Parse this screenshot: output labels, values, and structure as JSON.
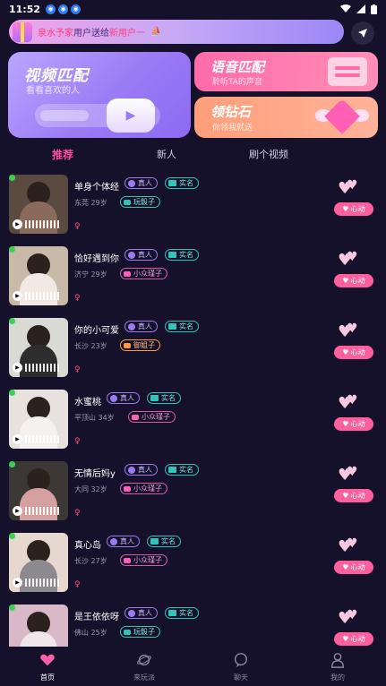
{
  "status": {
    "time": "11:52"
  },
  "notice": {
    "highlight_before": "泉水予家",
    "text": "用户送给",
    "highlight_after": "新用户一"
  },
  "cards": {
    "video": {
      "title": "视频匹配",
      "subtitle": "看看喜欢的人"
    },
    "voice": {
      "title": "语音匹配",
      "subtitle": "聆听TA的声音"
    },
    "diamond": {
      "title": "领钻石",
      "subtitle": "你领我就送"
    }
  },
  "tabs": [
    "推荐",
    "新人",
    "刷个视频"
  ],
  "badges": {
    "real": "真人",
    "name": "实名",
    "like": "心动"
  },
  "users": [
    {
      "name": "单身个体经",
      "city": "东莞",
      "age": "29岁",
      "tag": "玩骰子",
      "tag_style": "teal",
      "gender": "♀"
    },
    {
      "name": "恰好遇到你",
      "city": "济宁",
      "age": "29岁",
      "tag": "小众瑾子",
      "tag_style": "pink",
      "gender": "♀"
    },
    {
      "name": "你的小可爱",
      "city": "长沙",
      "age": "23岁",
      "tag": "御姐子",
      "tag_style": "orange",
      "gender": "♀"
    },
    {
      "name": "水蜜桃",
      "city": "平顶山",
      "age": "34岁",
      "tag": "小众瑾子",
      "tag_style": "pink",
      "gender": "♀"
    },
    {
      "name": "无情后妈y",
      "city": "大同",
      "age": "32岁",
      "tag": "小众瑾子",
      "tag_style": "pink",
      "gender": "♀"
    },
    {
      "name": "真心岛",
      "city": "长沙",
      "age": "27岁",
      "tag": "小众瑾子",
      "tag_style": "pink",
      "gender": "♀"
    },
    {
      "name": "是王依依呀",
      "city": "佛山",
      "age": "25岁",
      "tag": "玩骰子",
      "tag_style": "teal",
      "gender": "♀"
    }
  ],
  "nav": [
    {
      "label": "首页",
      "icon": "heart-icon"
    },
    {
      "label": "来玩派",
      "icon": "planet-icon"
    },
    {
      "label": "聊天",
      "icon": "chat-icon"
    },
    {
      "label": "我的",
      "icon": "user-icon"
    }
  ]
}
